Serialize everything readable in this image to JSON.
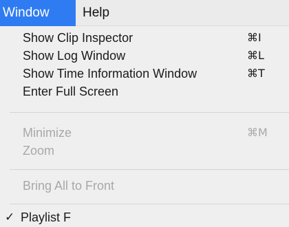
{
  "menubar": {
    "items": [
      {
        "label": "Window",
        "active": true
      },
      {
        "label": "Help",
        "active": false
      }
    ]
  },
  "menu": {
    "groups": [
      [
        {
          "label": "Show Clip Inspector",
          "shortcut": "⌘I",
          "enabled": true
        },
        {
          "label": "Show Log Window",
          "shortcut": "⌘L",
          "enabled": true
        },
        {
          "label": "Show Time Information Window",
          "shortcut": "⌘T",
          "enabled": true
        },
        {
          "label": "Enter Full Screen",
          "shortcut": "",
          "enabled": true
        }
      ],
      [
        {
          "label": "Minimize",
          "shortcut": "⌘M",
          "enabled": false
        },
        {
          "label": "Zoom",
          "shortcut": "",
          "enabled": false
        }
      ],
      [
        {
          "label": "Bring All to Front",
          "shortcut": "",
          "enabled": false
        }
      ],
      [
        {
          "label": "Playlist F",
          "shortcut": "",
          "enabled": true,
          "checked": true,
          "check_mark": "✓"
        }
      ]
    ]
  },
  "colors": {
    "accent": "#2f7cf2",
    "menu_bg": "#f0efef",
    "disabled_text": "#a9a8a8",
    "text": "#1a1a1a"
  }
}
